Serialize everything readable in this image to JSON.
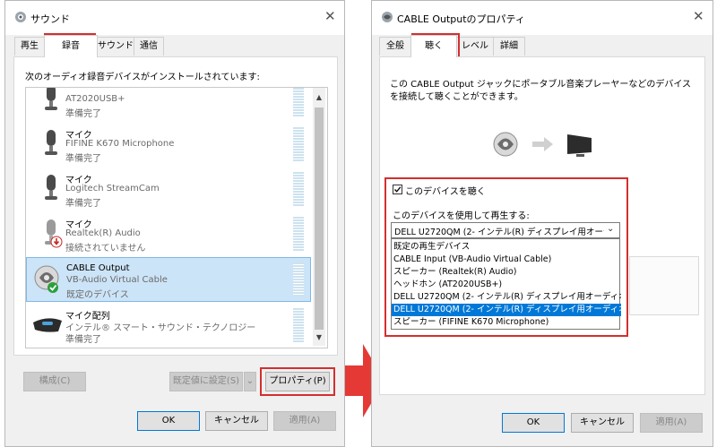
{
  "left_dialog": {
    "title": "サウンド",
    "tabs": [
      "再生",
      "録音",
      "サウンド",
      "通信"
    ],
    "instruction": "次のオーディオ録音デバイスがインストールされています:",
    "devices": [
      {
        "name": "",
        "sub": "AT2020USB+",
        "status": "準備完了",
        "icon": "microphone-icon"
      },
      {
        "name": "マイク",
        "sub": "FIFINE K670 Microphone",
        "status": "準備完了",
        "icon": "microphone-icon"
      },
      {
        "name": "マイク",
        "sub": "Logitech StreamCam",
        "status": "準備完了",
        "icon": "microphone-icon"
      },
      {
        "name": "マイク",
        "sub": "Realtek(R) Audio",
        "status": "接続されていません",
        "icon": "microphone-icon"
      },
      {
        "name": "CABLE Output",
        "sub": "VB-Audio Virtual Cable",
        "status": "既定のデバイス",
        "icon": "cable-icon"
      },
      {
        "name": "マイク配列",
        "sub": "インテル® スマート・サウンド・テクノロジー",
        "status": "準備完了",
        "icon": "mic-array-icon"
      }
    ],
    "buttons": {
      "configure": "構成(C)",
      "set_default": "既定値に設定(S)",
      "properties": "プロパティ(P)",
      "ok": "OK",
      "cancel": "キャンセル",
      "apply": "適用(A)"
    }
  },
  "right_dialog": {
    "title": "CABLE Outputのプロパティ",
    "tabs": [
      "全般",
      "聴く",
      "レベル",
      "詳細"
    ],
    "description": "この CABLE Output ジャックにポータブル音楽プレーヤーなどのデバイスを接続して聴くことができます。",
    "listen_checkbox": {
      "label": "このデバイスを聴く",
      "checked": true
    },
    "playback_label": "このデバイスを使用して再生する:",
    "selected_device": "DELL U2720QM (2- インテル(R) ディスプレイ用オーディオ",
    "dropdown_options": [
      "既定の再生デバイス",
      "CABLE Input (VB-Audio Virtual Cable)",
      "スピーカー (Realtek(R) Audio)",
      "ヘッドホン (AT2020USB+)",
      "DELL U2720QM (2- インテル(R) ディスプレイ用オーディオ)",
      "DELL U2720QM (2- インテル(R) ディスプレイ用オーディオ)",
      "スピーカー (FIFINE K670 Microphone)"
    ],
    "highlighted_option_index": 5,
    "buttons": {
      "ok": "OK",
      "cancel": "キャンセル",
      "apply": "適用(A)"
    }
  },
  "colors": {
    "highlight_red": "#d32f2f",
    "arrow_red": "#e53935",
    "selection_blue": "#0078d7",
    "selected_row": "#cce4f7"
  }
}
